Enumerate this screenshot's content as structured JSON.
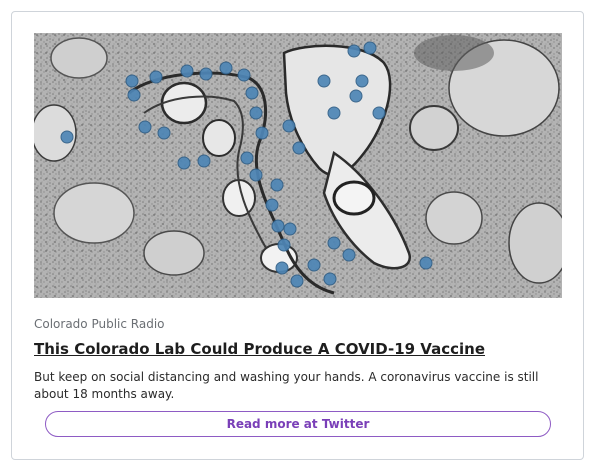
{
  "card": {
    "image_alt": "Electron micrograph of coronavirus particles",
    "source": "Colorado Public Radio",
    "headline": "This Colorado Lab Could Produce A COVID-19 Vaccine",
    "summary": "But keep on social distancing and washing your hands. A coronavirus vaccine is still about 18 months away.",
    "read_more_label": "Read more at Twitter"
  },
  "colors": {
    "accent": "#7a3fb8",
    "border": "#cfd4da",
    "virus_blue": "#4e86b6"
  }
}
